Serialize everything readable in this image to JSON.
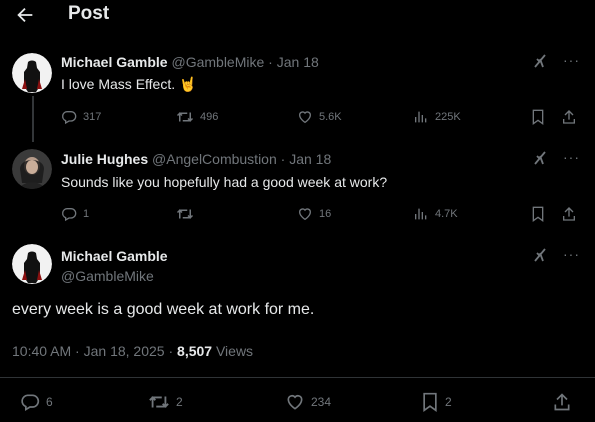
{
  "header": {
    "title": "Post"
  },
  "reply1": {
    "name": "Michael Gamble",
    "handle": "@GambleMike",
    "date": "Jan 18",
    "text": "I love Mass Effect. 🤘",
    "stats": {
      "replies": "317",
      "reposts": "496",
      "likes": "5.6K",
      "views": "225K"
    }
  },
  "reply2": {
    "name": "Julie Hughes",
    "handle": "@AngelCombustion",
    "date": "Jan 18",
    "text": "Sounds like you hopefully had a good week at work?",
    "stats": {
      "replies": "1",
      "reposts": "",
      "likes": "16",
      "views": "4.7K"
    }
  },
  "main": {
    "name": "Michael Gamble",
    "handle": "@GambleMike",
    "text": "every week is a good week at work for me.",
    "time": "10:40 AM",
    "date": "Jan 18, 2025",
    "views_count": "8,507",
    "views_label": "Views",
    "stats": {
      "replies": "6",
      "reposts": "2",
      "likes": "234",
      "bookmarks": "2"
    }
  },
  "separators": {
    "dot": "·"
  },
  "colors": {
    "background": "#000000",
    "text": "#e7e9ea",
    "muted": "#71767b",
    "divider": "#2f3336"
  },
  "icons": [
    "back-arrow-icon",
    "grok-icon",
    "more-icon",
    "reply-icon",
    "repost-icon",
    "like-icon",
    "views-icon",
    "bookmark-icon",
    "share-icon"
  ]
}
